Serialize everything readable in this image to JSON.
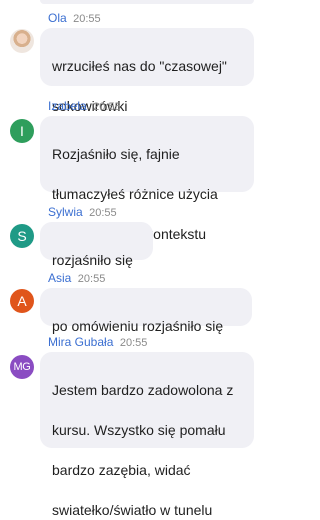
{
  "messages": [
    {
      "sender": "Ola",
      "time": "20:55",
      "avatar": {
        "type": "photo",
        "icon": "user-photo-icon",
        "color": "#e8d7c8"
      },
      "lines": [
        "wrzuciłeś nas do \"czasowej\"",
        "sokowirówki"
      ],
      "emoji": "laughing-with-tears-emoji"
    },
    {
      "sender": "Izabela",
      "time": "20:55",
      "avatar": {
        "type": "initials",
        "initials": "I",
        "color": "#2e9e5c"
      },
      "lines": [
        "Rozjaśniło się, fajnie",
        "tłumaczyłeś różnice użycia",
        "pod względem kontekstu"
      ]
    },
    {
      "sender": "Sylwia",
      "time": "20:55",
      "avatar": {
        "type": "initials",
        "initials": "S",
        "color": "#1f9a86"
      },
      "lines": [
        "rozjaśniło się"
      ]
    },
    {
      "sender": "Asia",
      "time": "20:55",
      "avatar": {
        "type": "initials",
        "initials": "A",
        "color": "#e0551b"
      },
      "lines": [
        "po omówieniu rozjaśniło się"
      ]
    },
    {
      "sender": "Mira Gubała",
      "time": "20:55",
      "avatar": {
        "type": "initials",
        "initials": "MG",
        "color": "#8a4cc2"
      },
      "lines": [
        "Jestem bardzo zadowolona z",
        "kursu. Wszystko się pomału",
        "bardzo zazębia, widać",
        "swiatełko/światło w tunelu"
      ]
    }
  ],
  "colors": {
    "sender_name": "#3b6fd1",
    "timestamp": "#8a8a8a",
    "bubble": "#f0f0f5",
    "message_text": "#1f1f1f"
  }
}
